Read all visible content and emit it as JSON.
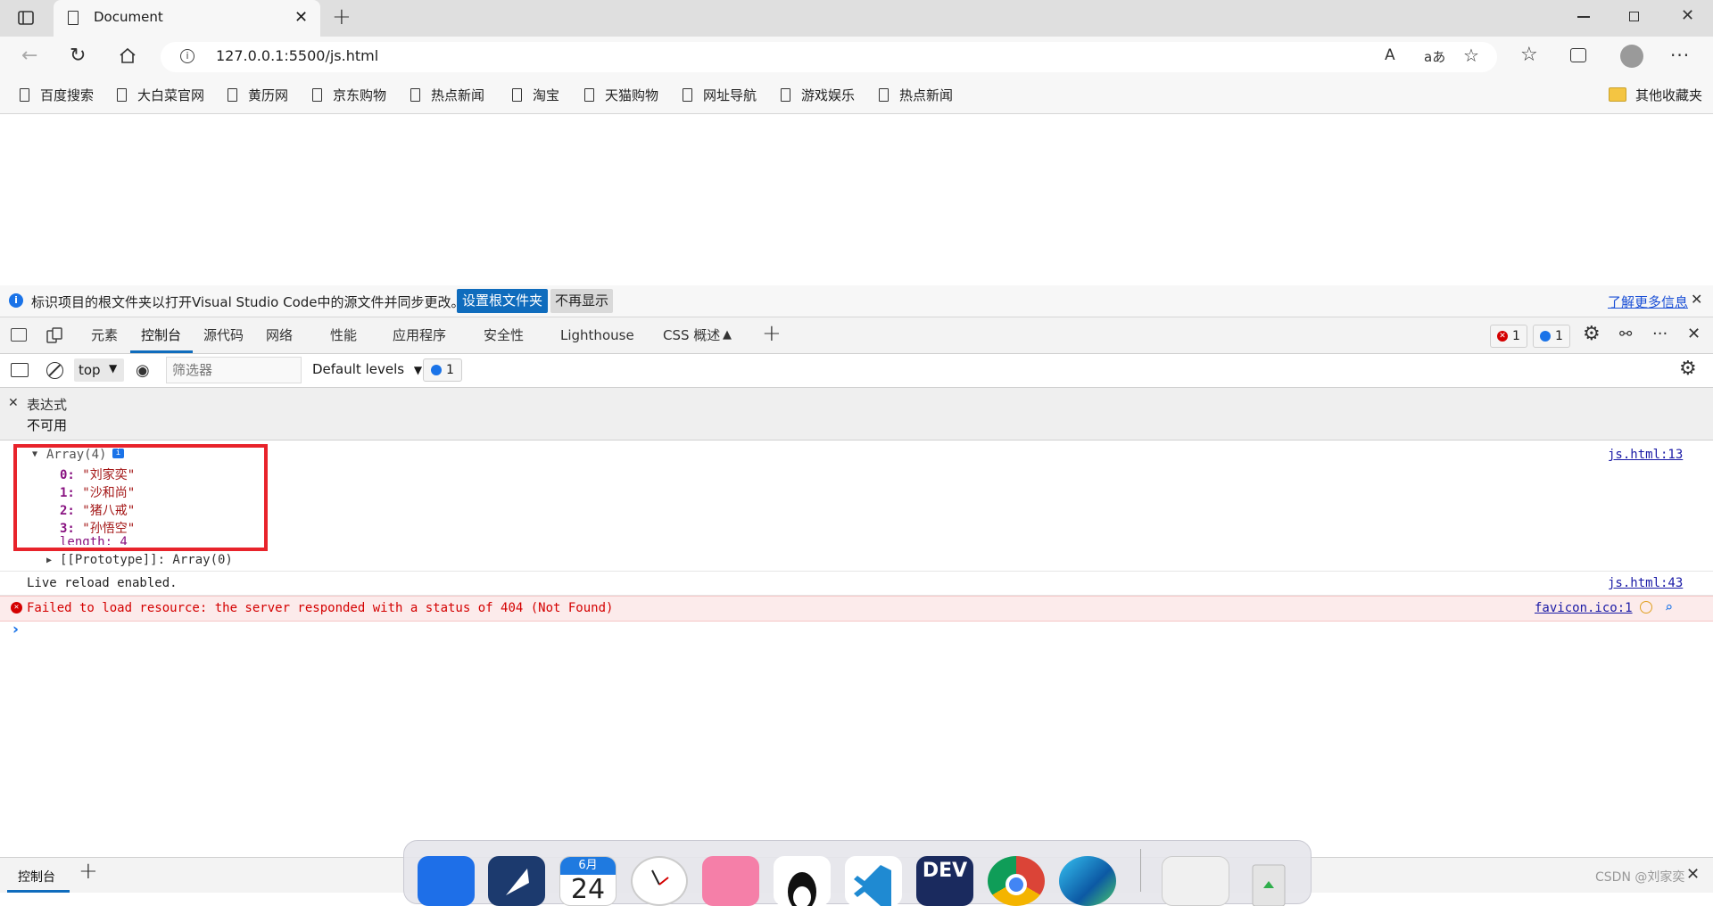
{
  "browser": {
    "tab_title": "Document",
    "url": "127.0.0.1:5500/js.html",
    "read_aloud": "A͡",
    "translate": "aあ"
  },
  "bookmarks": [
    "百度搜索",
    "大白菜官网",
    "黄历网",
    "京东购物",
    "热点新闻",
    "淘宝",
    "天猫购物",
    "网址导航",
    "游戏娱乐",
    "热点新闻"
  ],
  "other_bookmarks": "其他收藏夹",
  "infobar": {
    "message": "标识项目的根文件夹以打开Visual Studio Code中的源文件并同步更改。",
    "primary_button": "设置根文件夹",
    "secondary_button": "不再显示",
    "learn_more": "了解更多信息"
  },
  "devtools": {
    "tabs": [
      "元素",
      "控制台",
      "源代码",
      "网络",
      "性能",
      "应用程序",
      "安全性",
      "Lighthouse",
      "CSS 概述"
    ],
    "active_tab": "控制台",
    "error_count": "1",
    "info_count": "1"
  },
  "console_toolbar": {
    "context": "top",
    "filter_placeholder": "筛选器",
    "levels": "Default levels",
    "issue_count": "1"
  },
  "expression": {
    "label": "表达式",
    "value": "不可用"
  },
  "console": {
    "array_header": "Array(4)",
    "items": [
      {
        "index": "0:",
        "value": "\"刘家奕\""
      },
      {
        "index": "1:",
        "value": "\"沙和尚\""
      },
      {
        "index": "2:",
        "value": "\"猪八戒\""
      },
      {
        "index": "3:",
        "value": "\"孙悟空\""
      }
    ],
    "length_label": "length: 4",
    "prototype": "[[Prototype]]: Array(0)",
    "source1": "js.html:13",
    "live_reload": "Live reload enabled.",
    "source2": "js.html:43",
    "error_message": "Failed to load resource: the server responded with a status of 404 (Not Found)",
    "error_source": "favicon.ico:1"
  },
  "drawer": {
    "tab": "控制台"
  },
  "dock": {
    "calendar_month": "6月",
    "calendar_day": "24",
    "devcpp_label": "DEV"
  },
  "watermark": "CSDN @刘家奕",
  "colors": {
    "accent": "#0f6cbd",
    "error_bg": "#fcebeb",
    "error_text": "#d40000",
    "highlight_box": "#e8232b",
    "string_color": "#a31515",
    "index_color": "#881280"
  }
}
